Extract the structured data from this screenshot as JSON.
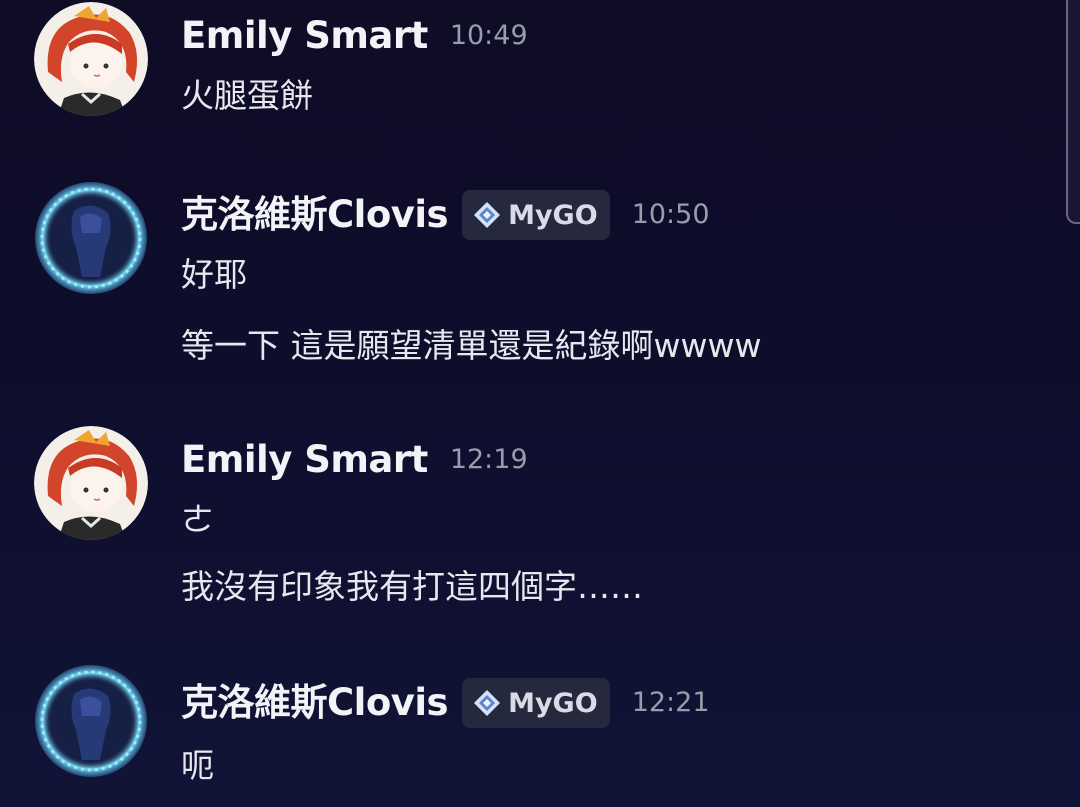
{
  "messages": [
    {
      "author": "Emily Smart",
      "time": "10:49",
      "role": null,
      "lines": [
        "火腿蛋餅"
      ]
    },
    {
      "author": "克洛維斯Clovis",
      "time": "10:50",
      "role": "MyGO",
      "lines": [
        "好耶",
        "等一下 這是願望清單還是紀錄啊wwww"
      ]
    },
    {
      "author": "Emily Smart",
      "time": "12:19",
      "role": null,
      "lines": [
        "ㄜ",
        "我沒有印象我有打這四個字……"
      ]
    },
    {
      "author": "克洛維斯Clovis",
      "time": "12:21",
      "role": "MyGO",
      "lines": [
        "呃"
      ]
    }
  ],
  "icons": {
    "role_icon": "diamond-sparkle-icon",
    "emily_avatar": "red-haired-anime-girl-avatar",
    "clovis_avatar": "blue-glowing-ring-avatar"
  },
  "colors": {
    "background": "#0f0c26",
    "username": "#f2f3f7",
    "timestamp": "#9a9cab",
    "role_tag_bg": "#26283d",
    "glow_ring": "#7fe3ff"
  }
}
